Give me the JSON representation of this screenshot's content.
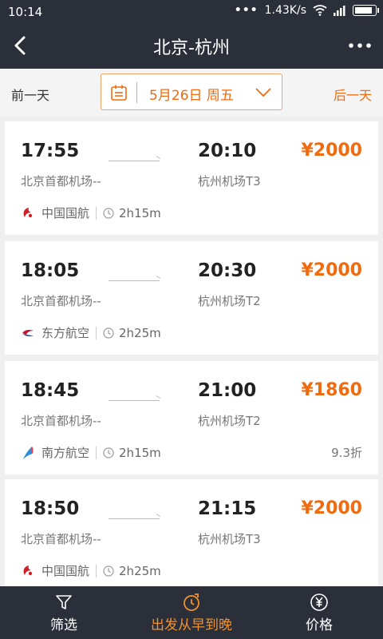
{
  "status": {
    "time": "10:14",
    "dots": "•••",
    "speed": "1.43K/s",
    "battery_level": 0.9
  },
  "nav": {
    "title": "北京-杭州"
  },
  "datebar": {
    "prev": "前一天",
    "date": "5月26日 周五",
    "next": "后一天"
  },
  "flights": [
    {
      "dep_time": "17:55",
      "arr_time": "20:10",
      "price": "¥2000",
      "dep_airport": "北京首都机场--",
      "arr_airport": "杭州机场T3",
      "airline": "中国国航",
      "airline_icon": "air-china-logo-icon",
      "duration": "2h15m",
      "discount": ""
    },
    {
      "dep_time": "18:05",
      "arr_time": "20:30",
      "price": "¥2000",
      "dep_airport": "北京首都机场--",
      "arr_airport": "杭州机场T2",
      "airline": "东方航空",
      "airline_icon": "china-eastern-logo-icon",
      "duration": "2h25m",
      "discount": ""
    },
    {
      "dep_time": "18:45",
      "arr_time": "21:00",
      "price": "¥1860",
      "dep_airport": "北京首都机场--",
      "arr_airport": "杭州机场T2",
      "airline": "南方航空",
      "airline_icon": "china-southern-logo-icon",
      "duration": "2h15m",
      "discount": "9.3折"
    },
    {
      "dep_time": "18:50",
      "arr_time": "21:15",
      "price": "¥2000",
      "dep_airport": "北京首都机场--",
      "arr_airport": "杭州机场T3",
      "airline": "中国国航",
      "airline_icon": "air-china-logo-icon",
      "duration": "2h25m",
      "discount": ""
    }
  ],
  "tabs": [
    {
      "label": "筛选",
      "icon": "filter-icon"
    },
    {
      "label": "出发从早到晚",
      "icon": "clock-sort-icon"
    },
    {
      "label": "价格",
      "icon": "yuan-icon"
    }
  ],
  "colors": {
    "accent": "#f06a0f",
    "dark": "#2b2f3a",
    "tab_active": "#f0912f"
  }
}
